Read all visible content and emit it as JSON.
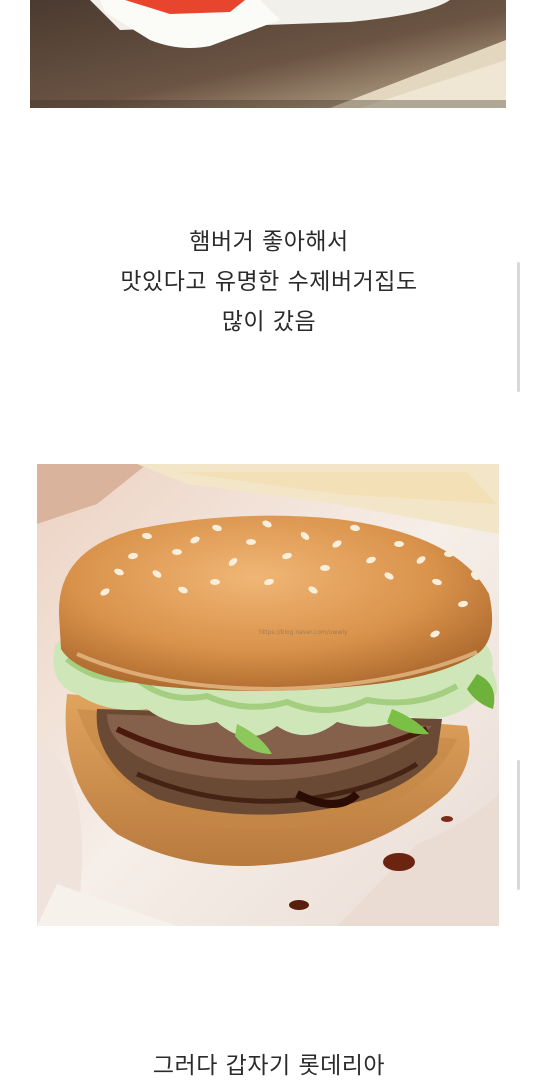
{
  "caption_1": {
    "lines": [
      "햄버거 좋아해서",
      "맛있다고 유명한 수제버거집도",
      "많이 갔음"
    ]
  },
  "burger_photo": {
    "watermark": "https://blog.naver.com/uwwly"
  },
  "caption_2": {
    "lines": [
      "그러다 갑자기 롯데리아"
    ]
  },
  "colors": {
    "background": "#ffffff",
    "text": "#2b2b2b",
    "bun": "#d9924a",
    "lettuce": "#b9dba0",
    "patty": "#6b4a35",
    "sauce": "#4a1a0e"
  }
}
